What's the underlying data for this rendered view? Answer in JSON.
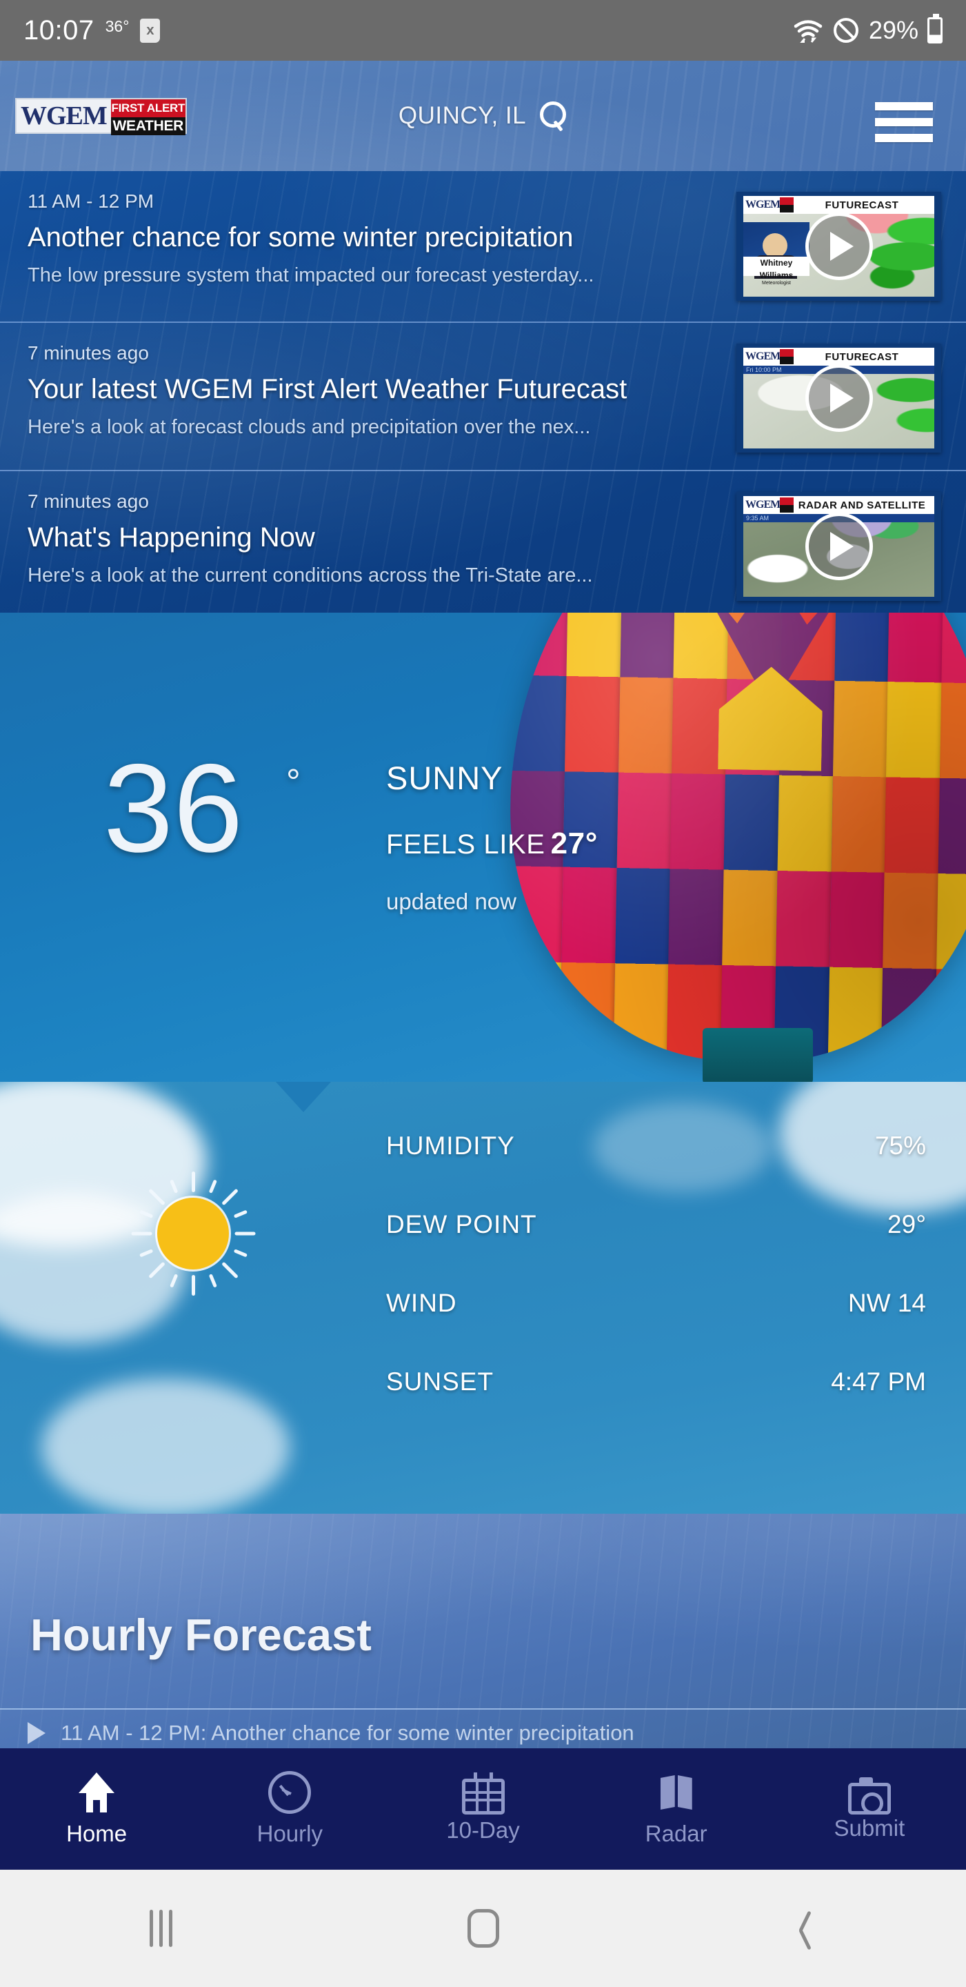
{
  "status_bar": {
    "clock": "10:07",
    "temp": "36°",
    "badge": "x",
    "battery_percent": "29%",
    "icons": [
      "wifi-icon",
      "do-not-disturb-icon",
      "battery-icon"
    ]
  },
  "header": {
    "logo_wgem": "WGEM",
    "logo_first_alert": "FIRST ALERT",
    "logo_weather": "WEATHER",
    "location": "QUINCY, IL",
    "search_icon": "search-icon",
    "menu_icon": "hamburger-menu-icon"
  },
  "news": [
    {
      "time": "11 AM - 12 PM",
      "title": "Another chance for some winter precipitation",
      "desc": "The low pressure system that impacted our forecast yesterday...",
      "thumb_label": "FUTURECAST",
      "thumb_sub": "",
      "anchor_name": "Whitney Williams",
      "anchor_role": "Meteorologist",
      "thumb_kind": "anchor"
    },
    {
      "time": "7 minutes ago",
      "title": "Your latest WGEM First Alert Weather Futurecast",
      "desc": "Here's a look at forecast clouds and precipitation over the nex...",
      "thumb_label": "FUTURECAST",
      "thumb_sub": "Fri  10:00 PM",
      "thumb_kind": "future"
    },
    {
      "time": "7 minutes ago",
      "title": "What's Happening Now",
      "desc": "Here's a look at the current conditions across the Tri-State are...",
      "thumb_label": "RADAR AND SATELLITE",
      "thumb_sub": "9:35 AM",
      "thumb_kind": "radar"
    }
  ],
  "current": {
    "temperature": "36",
    "degree": "°",
    "condition": "SUNNY",
    "feels_like_label": "FEELS LIKE",
    "feels_like_value": "27°",
    "updated": "updated now",
    "weather_icon": "sun-icon"
  },
  "details": {
    "rows": [
      {
        "label": "HUMIDITY",
        "value": "75%"
      },
      {
        "label": "DEW POINT",
        "value": "29°"
      },
      {
        "label": "WIND",
        "value": "NW 14"
      },
      {
        "label": "SUNSET",
        "value": "4:47 PM"
      }
    ]
  },
  "hourly": {
    "title": "Hourly Forecast",
    "first_row": "11 AM - 12 PM: Another chance for some winter precipitation"
  },
  "bottom_nav": [
    {
      "label": "Home",
      "icon": "home-icon",
      "active": true
    },
    {
      "label": "Hourly",
      "icon": "clock-icon",
      "active": false
    },
    {
      "label": "10-Day",
      "icon": "calendar-icon",
      "active": false
    },
    {
      "label": "Radar",
      "icon": "map-icon",
      "active": false
    },
    {
      "label": "Submit",
      "icon": "camera-icon",
      "active": false
    }
  ],
  "android_nav": [
    {
      "icon": "recents-icon"
    },
    {
      "icon": "home-pill-icon"
    },
    {
      "icon": "back-icon"
    }
  ],
  "colors": {
    "status_bar_bg": "#6b6b6b",
    "header_bg": "#4f79b5",
    "news_bg": "#0f478f",
    "hero_bg": "#1877b8",
    "details_bg": "#2a86bd",
    "hourly_bg": "#5b81c0",
    "bottom_nav_bg": "#121a5c",
    "accent_red": "#cc1122",
    "sun_yellow": "#f7bf17"
  }
}
